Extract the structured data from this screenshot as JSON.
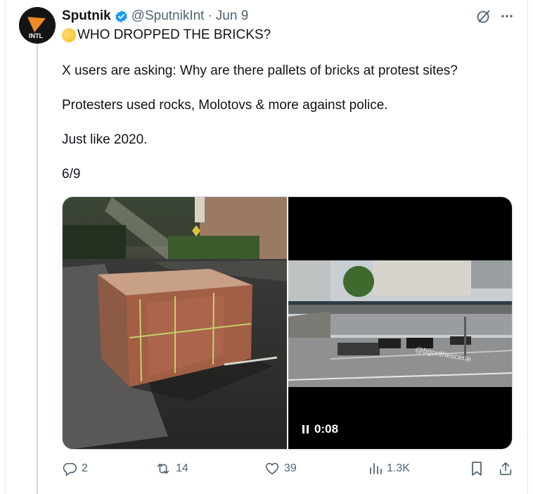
{
  "tweet": {
    "author_name": "Sputnik",
    "author_handle": "@SputnikInt",
    "separator": "·",
    "date": "Jun 9",
    "avatar_label": "INTL",
    "lines": [
      "WHO DROPPED THE BRICKS?",
      "X users are asking: Why are there pallets of bricks at protest sites?",
      "Protesters used rocks, Molotovs & more against police.",
      "Just like 2020.",
      "6/9"
    ]
  },
  "media": {
    "video_time": "0:08",
    "watermark": "@bgonthescene"
  },
  "actions": {
    "replies": "2",
    "retweets": "14",
    "likes": "39",
    "views": "1.3K"
  },
  "icons": {
    "verified": "verified-badge-icon",
    "grok": "grok-icon",
    "more": "more-icon",
    "reply": "reply-icon",
    "retweet": "retweet-icon",
    "like": "heart-icon",
    "views": "views-icon",
    "bookmark": "bookmark-icon",
    "share": "share-icon"
  },
  "colors": {
    "verified": "#1d9bf0",
    "text": "#0f1419",
    "muted": "#536471",
    "avatar_accent": "#f08a24"
  }
}
